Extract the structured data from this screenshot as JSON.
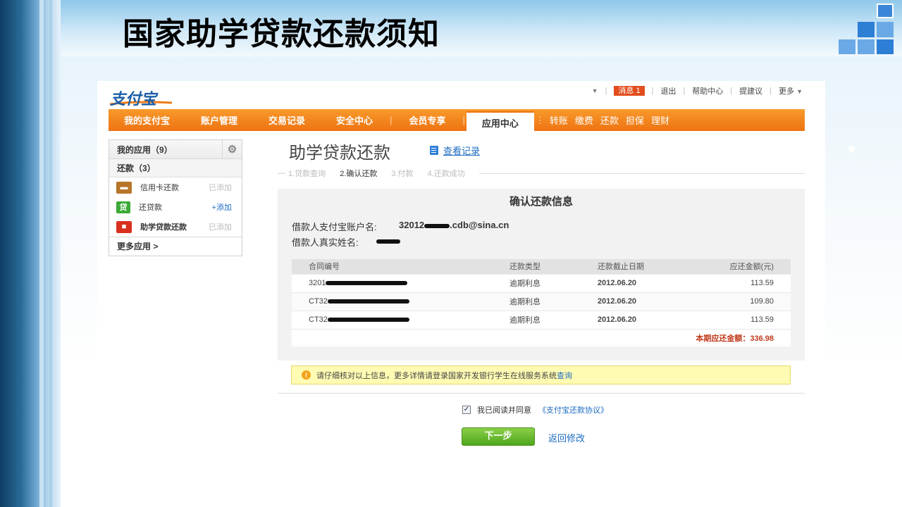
{
  "slide": {
    "title": "国家助学贷款还款须知"
  },
  "header": {
    "logo_text": "支付宝",
    "top_links": {
      "caret": "▼",
      "message_label": "消息",
      "message_count": "1",
      "logout": "退出",
      "help": "帮助中心",
      "suggest": "提建议",
      "more": "更多"
    }
  },
  "nav": {
    "items": [
      "我的支付宝",
      "账户管理",
      "交易记录",
      "安全中心",
      "会员专享",
      "应用中心"
    ],
    "active": "应用中心",
    "sub_items": [
      "转账",
      "缴费",
      "还款",
      "担保",
      "理财"
    ]
  },
  "sidebar": {
    "my_apps": "我的应用（9）",
    "repay_group": "还款（3）",
    "apps": [
      {
        "label": "信用卡还款",
        "status": "已添加",
        "icon_text": "",
        "icon_color": "#b7752a"
      },
      {
        "label": "还贷款",
        "status": "+添加",
        "icon_text": "贷",
        "icon_color": "#3aa935"
      },
      {
        "label": "助学贷款还款",
        "status": "已添加",
        "icon_text": "",
        "icon_color": "#d8311d"
      }
    ],
    "more_apps": "更多应用 >"
  },
  "main": {
    "title": "助学贷款还款",
    "view_records": "查看记录",
    "steps": [
      "1.贷款查询",
      "2.确认还款",
      "3.付款",
      "4.还款成功"
    ],
    "confirm_title": "确认还款信息",
    "account_label": "借款人支付宝账户名:",
    "account_prefix": "32012",
    "account_suffix": ".cdb@sina.cn",
    "name_label": "借款人真实姓名:",
    "table": {
      "headers": [
        "合同编号",
        "还款类型",
        "还款截止日期",
        "应还金额(元)"
      ],
      "rows": [
        {
          "contract_prefix": "3201",
          "type": "逾期利息",
          "date": "2012.06.20",
          "amount": "113.59"
        },
        {
          "contract_prefix": "CT32",
          "type": "逾期利息",
          "date": "2012.06.20",
          "amount": "109.80"
        },
        {
          "contract_prefix": "CT32",
          "type": "逾期利息",
          "date": "2012.06.20",
          "amount": "113.59"
        }
      ],
      "total_label": "本期应还金额：",
      "total_value": "336.98"
    },
    "notice_text": "请仔细核对以上信息，更多详情请登录国家开发银行学生在线服务系统",
    "notice_link": "查询",
    "agree_text": "我已阅读并同意",
    "agree_link": "《支付宝还款协议》",
    "next_button": "下一步",
    "back_link": "返回修改"
  },
  "colors": {
    "nav_orange": "#ee7311",
    "link_blue": "#1d6cc2",
    "total_red": "#c0391b",
    "button_green": "#4fa61c"
  }
}
